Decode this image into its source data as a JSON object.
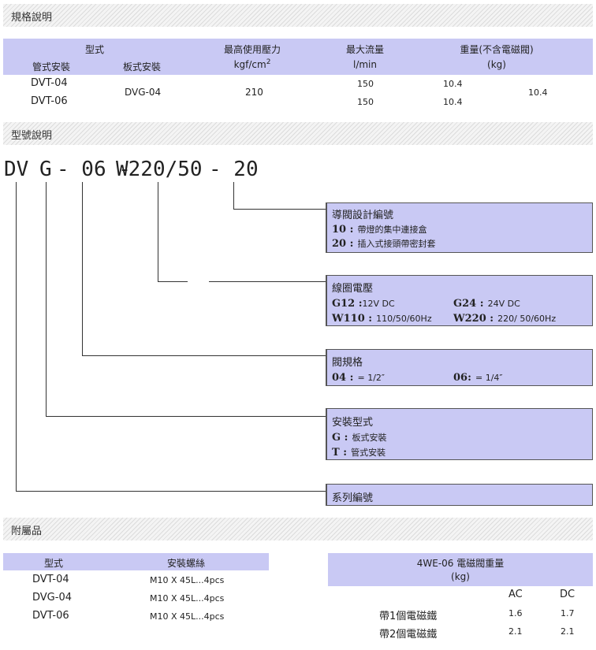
{
  "sections": {
    "spec": "規格說明",
    "model": "型號說明",
    "accessories": "附屬品"
  },
  "spec_table": {
    "h_type": "型式",
    "h_pipe": "管式安裝",
    "h_plate": "板式安裝",
    "h_pressure": "最高使用壓力",
    "h_pressure_unit_base": "kgf/cm",
    "h_pressure_unit_sup": "2",
    "h_flow": "最大流量",
    "h_flow_unit": "l/min",
    "h_weight": "重量(不含電磁閥)",
    "h_weight_unit": "(kg)",
    "row1_pipe": "DVT-04",
    "row2_pipe": "DVT-06",
    "plate": "DVG-04",
    "pressure": "210",
    "flow1": "150",
    "flow2": "150",
    "w1": "10.4",
    "w2": "10.4",
    "w3": "10.4"
  },
  "code": {
    "p1": "DV",
    "p2": "G",
    "p3": "- 06 -",
    "p4": "W220/50",
    "p5": "- 20"
  },
  "boxes": {
    "b1": {
      "title": "導閥設計編號",
      "l1k": "10 :",
      "l1v": "帶燈的集中連接盒",
      "l2k": "20 :",
      "l2v": "插入式接頭帶密封套"
    },
    "b2": {
      "title": "線圈電壓",
      "a_k": "G12 :",
      "a_v": "12V DC",
      "b_k": "G24 :",
      "b_v": "24V DC",
      "c_k": "W110 :",
      "c_v": "110/50/60Hz",
      "d_k": "W220 :",
      "d_v": "220/ 50/60Hz"
    },
    "b3": {
      "title": "閥規格",
      "a_k": "04 :",
      "a_v": "= 1/2″",
      "b_k": "06:",
      "b_v": "= 1/4″"
    },
    "b4": {
      "title": "安裝型式",
      "a_k": "G :",
      "a_v": "板式安裝",
      "b_k": "T :",
      "b_v": "管式安裝"
    },
    "b5": {
      "title": "系列編號"
    }
  },
  "acc_table": {
    "h_type": "型式",
    "h_screw": "安裝螺絲",
    "rows": [
      {
        "type": "DVT-04",
        "screw": "M10 X 45L...4pcs"
      },
      {
        "type": "DVG-04",
        "screw": "M10 X 45L...4pcs"
      },
      {
        "type": "DVT-06",
        "screw": "M10 X 45L...4pcs"
      }
    ]
  },
  "weight_table": {
    "title": "4WE-06 電磁閥重量",
    "unit": "(kg)",
    "ac": "AC",
    "dc": "DC",
    "rows": [
      {
        "label": "帶1個電磁鐵",
        "ac": "1.6",
        "dc": "1.7"
      },
      {
        "label": "帶2個電磁鐵",
        "ac": "2.1",
        "dc": "2.1"
      }
    ]
  }
}
